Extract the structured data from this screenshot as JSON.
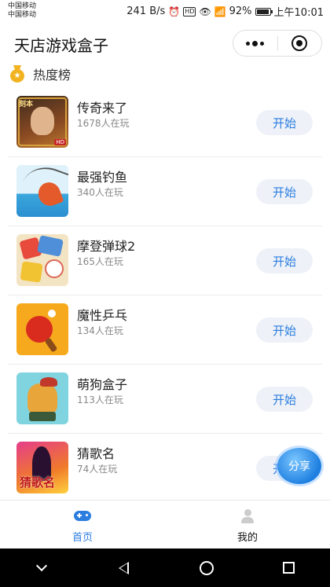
{
  "status_bar": {
    "carrier_1": "中国移动",
    "carrier_2": "中国移动",
    "speed": "241 B/s",
    "battery": "92%",
    "battery_level": 0.92,
    "time": "上午10:01"
  },
  "navbar": {
    "title": "天店游戏盒子"
  },
  "section": {
    "title": "热度榜"
  },
  "games": [
    {
      "name": "传奇来了",
      "players": "1678人在玩",
      "action": "开始"
    },
    {
      "name": "最强钓鱼",
      "players": "340人在玩",
      "action": "开始"
    },
    {
      "name": "摩登弹球2",
      "players": "165人在玩",
      "action": "开始"
    },
    {
      "name": "魔性乒乓",
      "players": "134人在玩",
      "action": "开始"
    },
    {
      "name": "萌狗盒子",
      "players": "113人在玩",
      "action": "开始"
    },
    {
      "name": "猜歌名",
      "players": "74人在玩",
      "action": "开始"
    }
  ],
  "thumb_text": {
    "t1_tag": "刻本",
    "t1_badge": "HD",
    "t6_text": "猜歌名"
  },
  "share": {
    "label": "分享"
  },
  "tabbar": {
    "tabs": [
      {
        "label": "首页",
        "active": true,
        "icon": "gamepad-icon"
      },
      {
        "label": "我的",
        "active": false,
        "icon": "person-icon"
      }
    ]
  },
  "colors": {
    "accent": "#2b7de0",
    "button_bg": "#eef2f8",
    "medal": "#f2b321"
  }
}
